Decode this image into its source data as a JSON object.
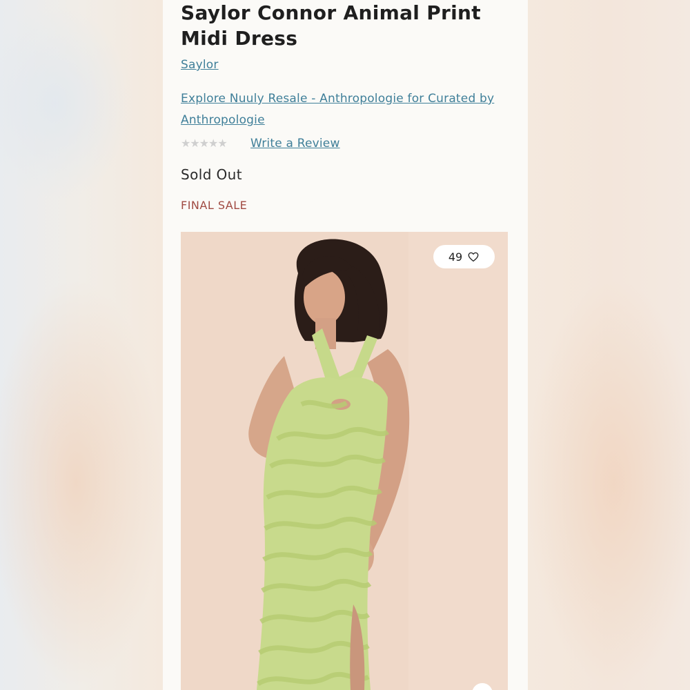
{
  "product": {
    "title": "Saylor Connor Animal Print Midi Dress",
    "brand": "Saylor",
    "collection_link": "Explore Nuuly Resale - Anthropologie for Curated by Anthropologie",
    "rating_stars": "★★★★★",
    "rating_value": 0,
    "review_link": "Write a Review",
    "availability": "Sold Out",
    "sale_note": "FINAL SALE",
    "favorites_count": "49"
  },
  "icons": {
    "favorite": "heart-outline-icon",
    "stars": "star-icon"
  },
  "colors": {
    "link": "#3f7f99",
    "sale": "#a04a42",
    "dress": "#c8d98a",
    "photo_bg": "#efd8c8"
  }
}
